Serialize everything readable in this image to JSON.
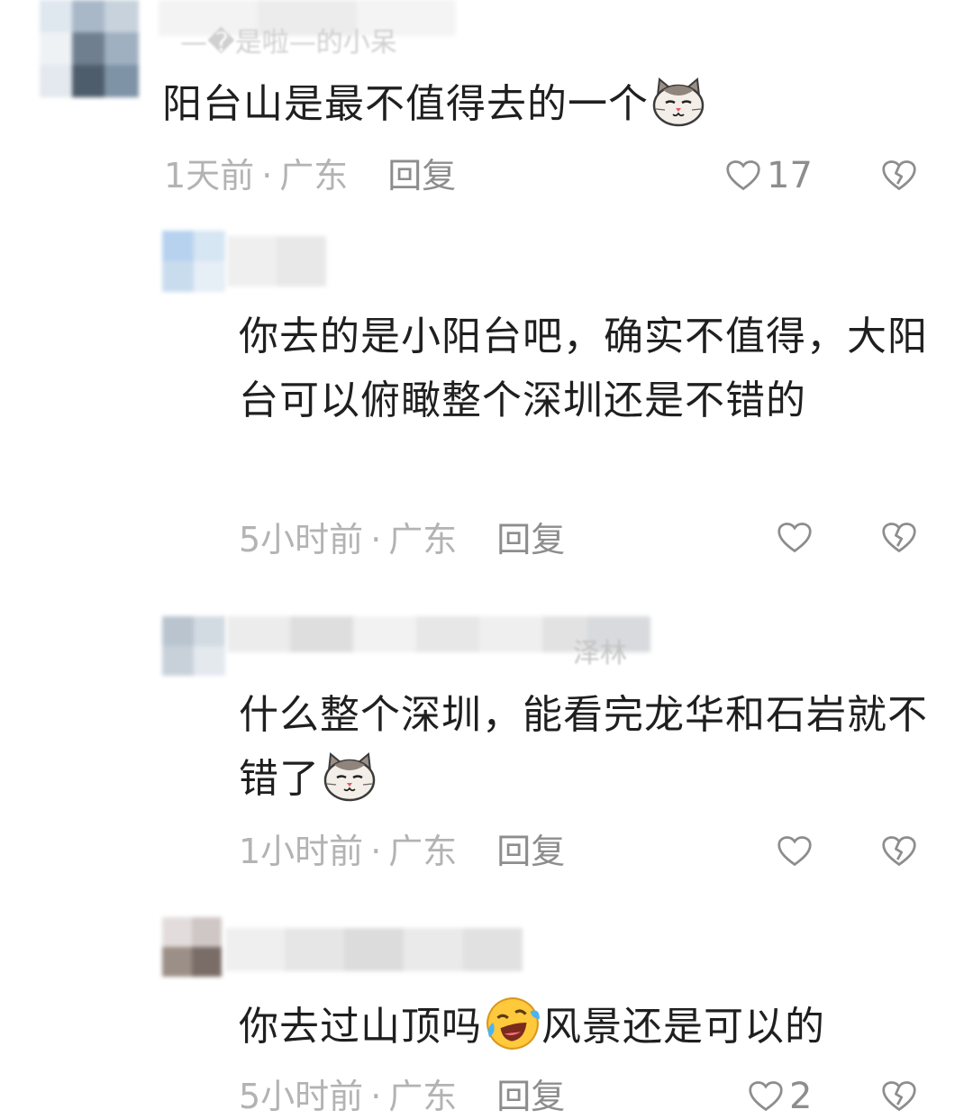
{
  "comments": [
    {
      "name_fragment": "—�是啦—的小呆",
      "text": "阳台山是最不值得去的一个",
      "time": "1天前",
      "region": "广东",
      "reply": "回复",
      "likes": "17"
    },
    {
      "text": "你去的是小阳台吧，确实不值得，大阳台可以俯瞰整个深圳还是不错的",
      "time": "5小时前",
      "region": "广东",
      "reply": "回复",
      "likes": ""
    },
    {
      "name_fragment": "泽林",
      "text": "什么整个深圳，能看完龙华和石岩就不错了",
      "time": "1小时前",
      "region": "广东",
      "reply": "回复",
      "likes": ""
    },
    {
      "text": "你去过山顶吗",
      "text_after": "风景还是可以的",
      "time": "5小时前",
      "region": "广东",
      "reply": "回复",
      "likes": "2"
    }
  ],
  "separator": "·",
  "icons": {
    "like": "heart-outline-icon",
    "dislike": "broken-heart-icon",
    "emoji_cat": "cat-face-emoji",
    "emoji_laugh": "rolling-laugh-emoji"
  },
  "colors": {
    "text": "#1f1f1f",
    "meta": "#b3b3b3",
    "action": "#8d8d8d"
  }
}
